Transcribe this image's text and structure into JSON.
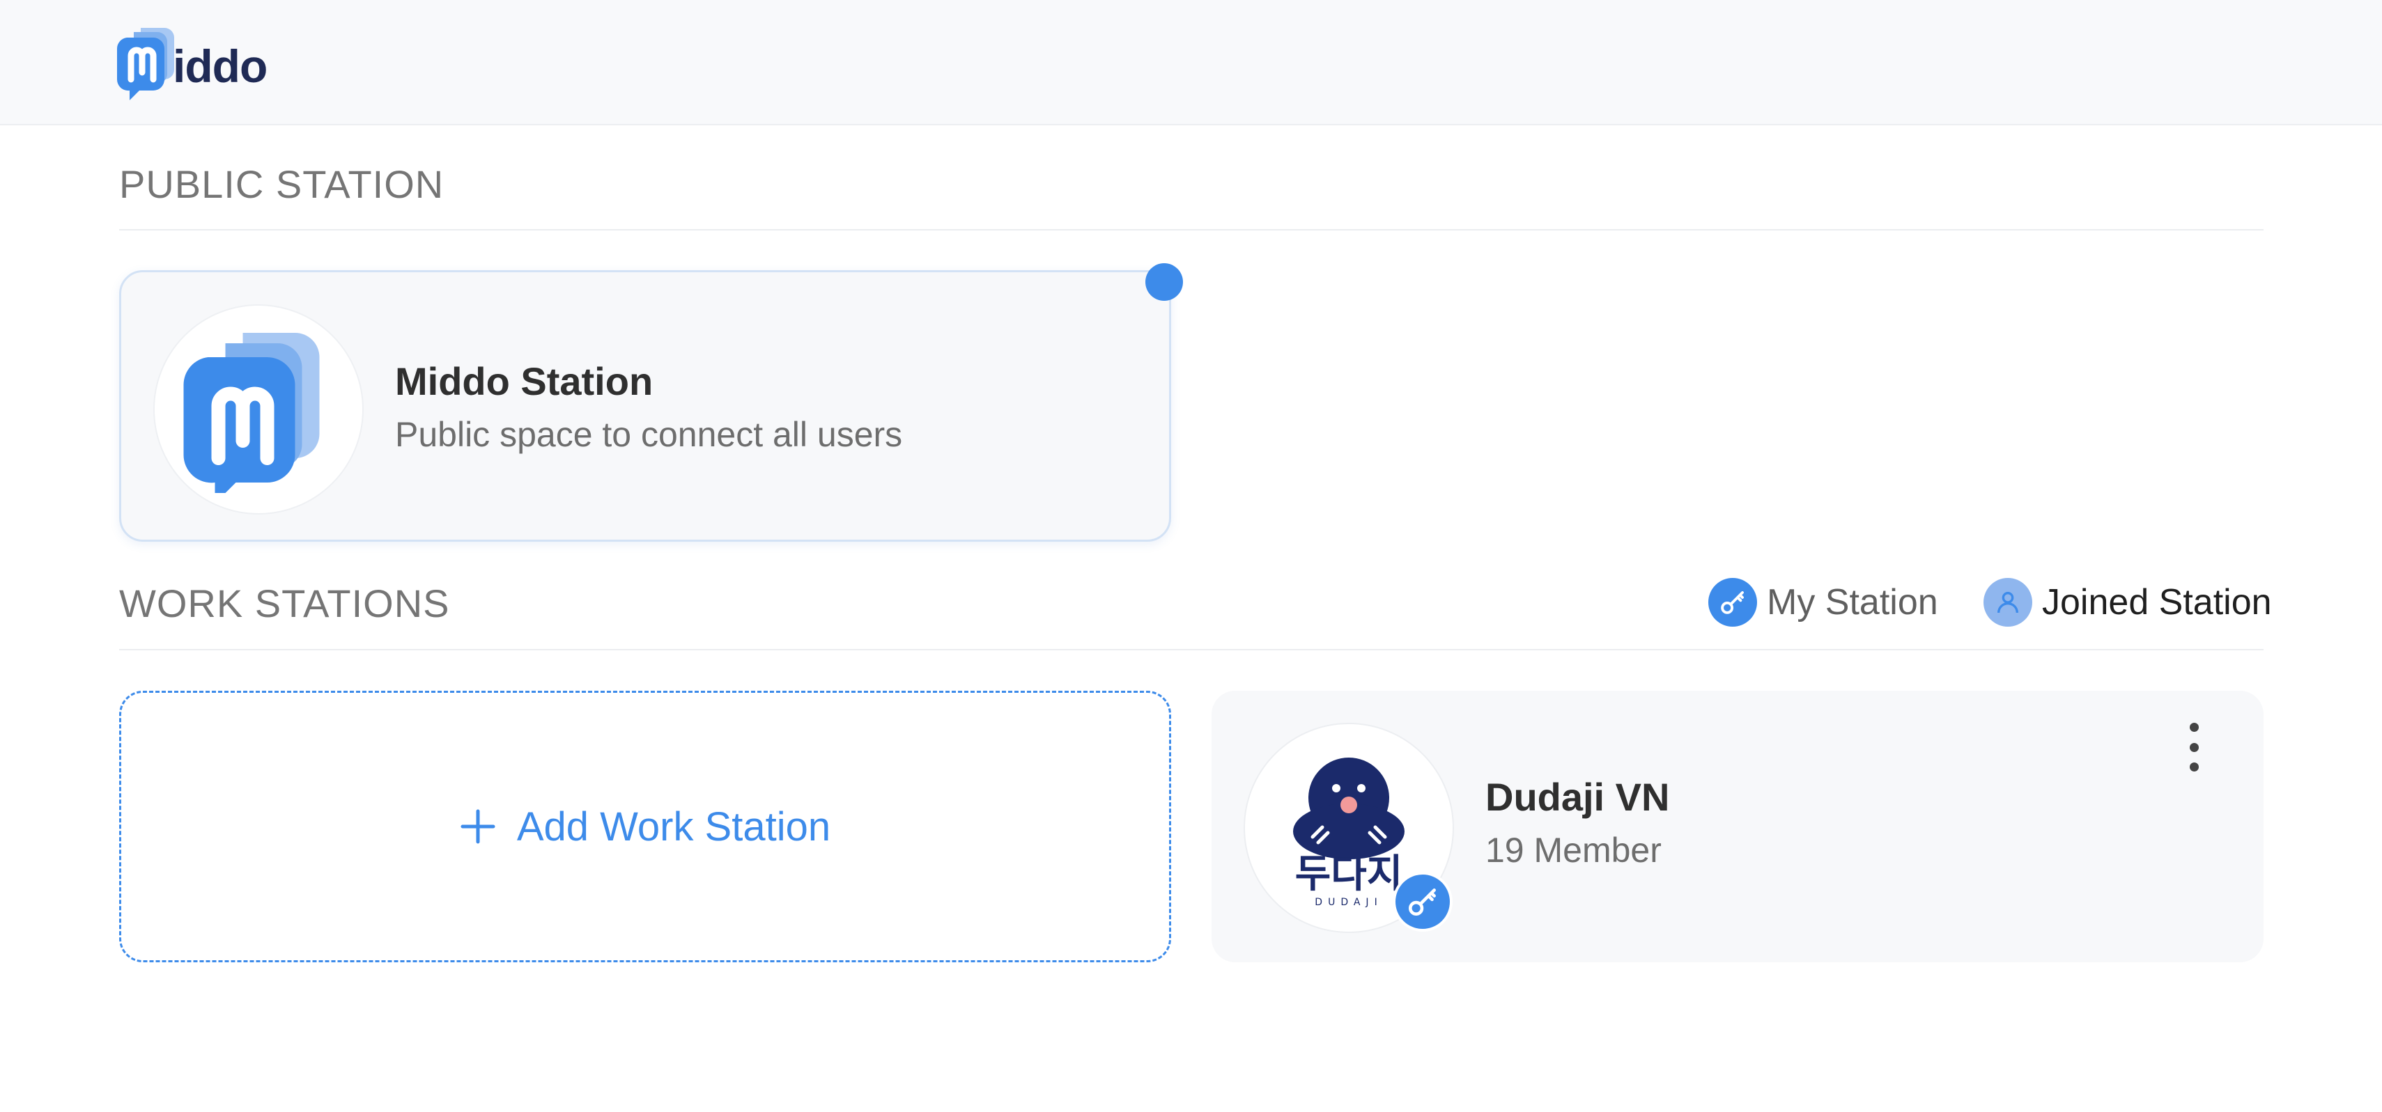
{
  "brand": {
    "name": "iddo",
    "accent": "#3d8bea",
    "dark": "#1f2a55"
  },
  "public_section": {
    "title": "PUBLIC STATION",
    "station": {
      "name": "Middo Station",
      "description": "Public space to connect all users",
      "indicator_color": "#3d8bea"
    }
  },
  "work_section": {
    "title": "WORK STATIONS",
    "legend": {
      "my_station": {
        "label": "My Station",
        "icon": "key-icon"
      },
      "joined_station": {
        "label": "Joined Station",
        "icon": "user-icon"
      }
    },
    "add_label": "Add Work Station",
    "stations": [
      {
        "name": "Dudaji VN",
        "members": "19 Member",
        "logo_text": "두다지",
        "logo_sub": "DUDAJI",
        "role_icon": "key-icon"
      }
    ]
  }
}
